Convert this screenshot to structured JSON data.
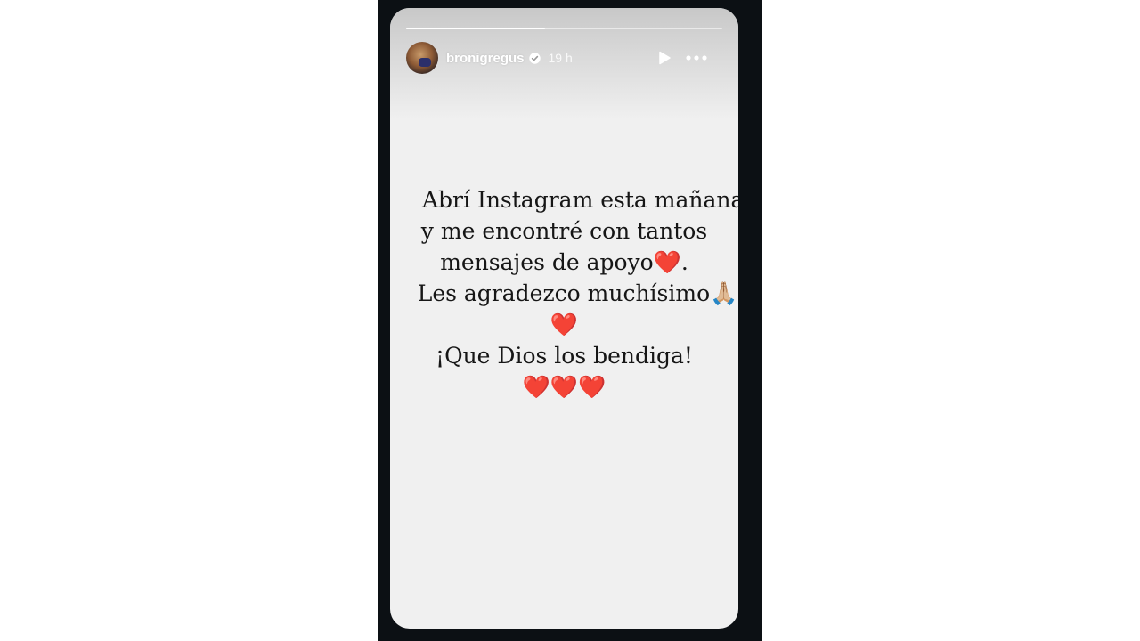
{
  "story": {
    "username": "bronigregus",
    "timestamp": "19 h",
    "verified": true,
    "progress": 0.44
  },
  "message": {
    "line1": "Abrí Instagram esta mañana",
    "line2": "y me encontré con tantos",
    "line3": "mensajes de apoyo❤️.",
    "line4": "Les agradezco muchísimo🙏🏼",
    "line5": "❤️",
    "line6": "¡Que Dios los bendiga!",
    "line7": "❤️❤️❤️"
  },
  "icons": {
    "verified": "verified-badge-icon",
    "play": "play-icon",
    "more": "more-options-icon"
  },
  "colors": {
    "frame": "#0c1014",
    "card": "#f0f0f0",
    "text": "#161616"
  }
}
